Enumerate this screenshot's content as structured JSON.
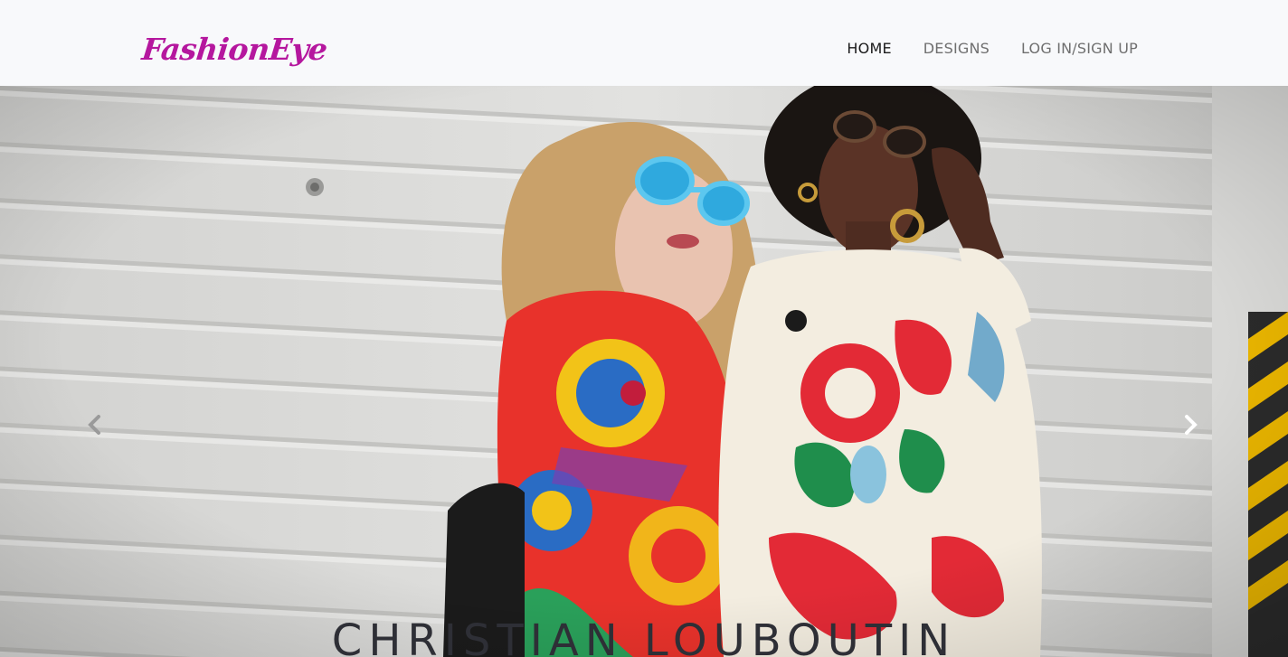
{
  "brand": {
    "name": "FashionEye",
    "color": "#b5179e"
  },
  "nav": {
    "items": [
      {
        "label": "HOME",
        "active": true
      },
      {
        "label": "DESIGNS",
        "active": false
      },
      {
        "label": "LOG IN/SIGN UP",
        "active": false
      }
    ]
  },
  "carousel": {
    "caption": "CHRISTIAN LOUBOUTIN",
    "prev_icon": "chevron-left-icon",
    "next_icon": "chevron-right-icon",
    "slide_image": "two-women-in-colorful-patterned-jackets-and-sunglasses"
  }
}
